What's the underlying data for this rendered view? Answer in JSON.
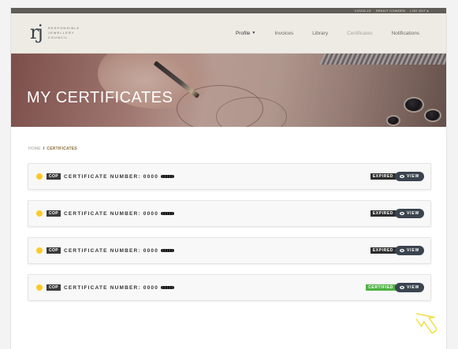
{
  "utility": {
    "covid": "COVID-19",
    "user": "SENAIT COWDEN",
    "logout": "LOG OUT"
  },
  "logo": {
    "mark": "rj",
    "line1": "RESPONSIBLE",
    "line2": "JEWELLERY",
    "line3": "COUNCIL"
  },
  "nav": {
    "profile": "Profile",
    "invoices": "Invoices",
    "library": "Library",
    "certificates": "Certificates",
    "notifications": "Notifications"
  },
  "hero": {
    "title": "MY CERTIFICATES"
  },
  "breadcrumb": {
    "home": "HOME",
    "sep": "/",
    "current": "CERTIFICATES"
  },
  "certificates": [
    {
      "badge": "COP",
      "number": "CERTIFICATE NUMBER: 0000",
      "status": "EXPIRED",
      "view": "VIEW"
    },
    {
      "badge": "COP",
      "number": "CERTIFICATE NUMBER: 0000",
      "status": "EXPIRED",
      "view": "VIEW"
    },
    {
      "badge": "COP",
      "number": "CERTIFICATE NUMBER: 0000",
      "status": "EXPIRED",
      "view": "VIEW"
    },
    {
      "badge": "COP",
      "number": "CERTIFICATE NUMBER: 0000",
      "status": "CERTIFIED",
      "view": "VIEW"
    }
  ],
  "colors": {
    "header_bg": "#eeebe5",
    "status_dot": "#ffc928",
    "expired": "#2d2d2d",
    "certified": "#4eb243",
    "view_button": "#3a444f",
    "breadcrumb_current": "#8b6f3f"
  },
  "icons": {
    "view": "eye-icon",
    "profile_dropdown": "chevron-down-icon",
    "logout": "logout-icon",
    "cursor": "arrow-cursor-icon"
  }
}
